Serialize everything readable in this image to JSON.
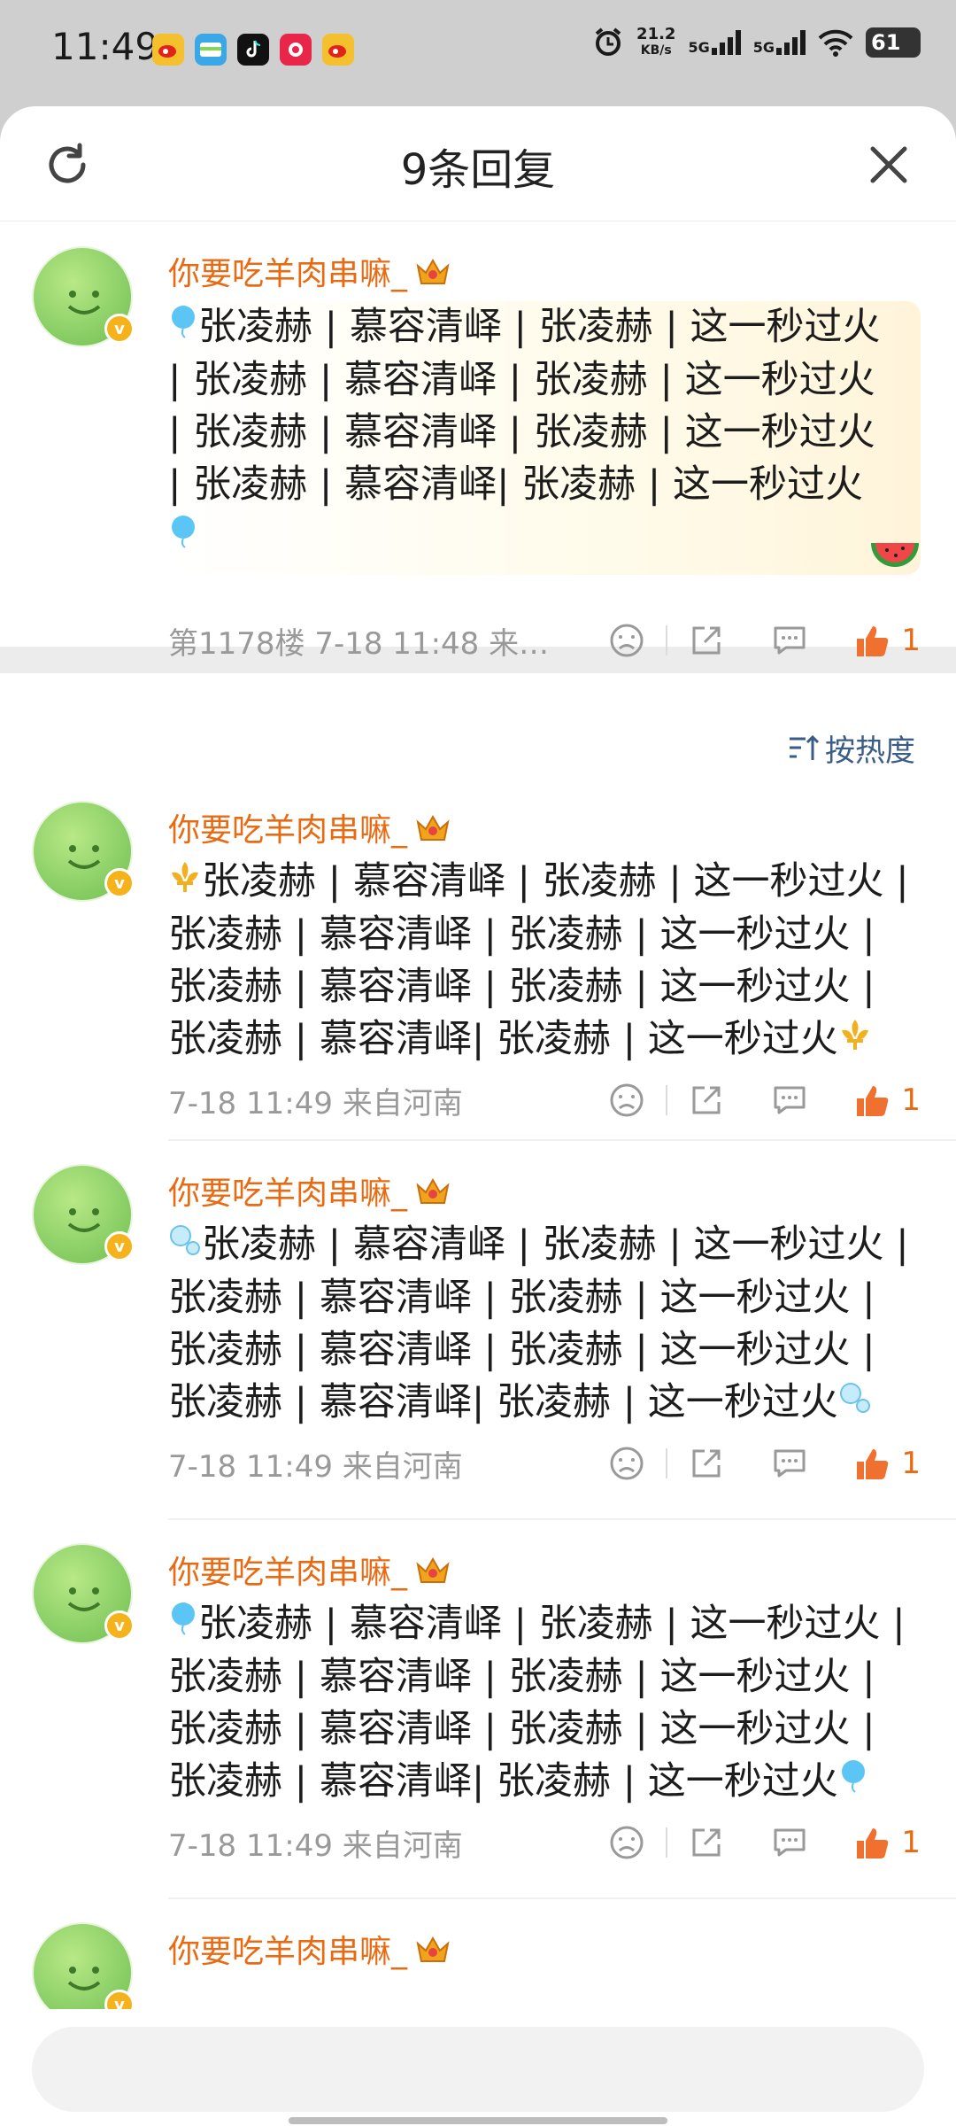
{
  "status_bar": {
    "time": "11:49",
    "speed_value": "21.2",
    "speed_unit": "KB/s",
    "signal1": "5G",
    "signal2": "5G",
    "battery": "61"
  },
  "sheet": {
    "title": "9条回复"
  },
  "pinned": {
    "username": "你要吃羊肉串嘛_",
    "content": "张凌赫 | 慕容清峄 | 张凌赫 | 这一秒过火 | 张凌赫 | 慕容清峄 | 张凌赫 | 这一秒过火 | 张凌赫 | 慕容清峄 | 张凌赫 | 这一秒过火 | 张凌赫 | 慕容清峄| 张凌赫 | 这一秒过火",
    "meta": "第1178楼 7-18 11:48 来…",
    "likes": "1"
  },
  "sort": {
    "label": "按热度"
  },
  "replies": [
    {
      "username": "你要吃羊肉串嘛_",
      "content": "张凌赫 | 慕容清峄 | 张凌赫 | 这一秒过火 | 张凌赫 | 慕容清峄 | 张凌赫 | 这一秒过火 | 张凌赫 | 慕容清峄 | 张凌赫 | 这一秒过火 | 张凌赫 | 慕容清峄| 张凌赫 | 这一秒过火",
      "meta": "7-18 11:49 来自河南",
      "likes": "1"
    },
    {
      "username": "你要吃羊肉串嘛_",
      "content": "张凌赫 | 慕容清峄 | 张凌赫 | 这一秒过火 | 张凌赫 | 慕容清峄 | 张凌赫 | 这一秒过火 | 张凌赫 | 慕容清峄 | 张凌赫 | 这一秒过火 | 张凌赫 | 慕容清峄| 张凌赫 | 这一秒过火",
      "meta": "7-18 11:49 来自河南",
      "likes": "1"
    },
    {
      "username": "你要吃羊肉串嘛_",
      "content": "张凌赫 | 慕容清峄 | 张凌赫 | 这一秒过火 | 张凌赫 | 慕容清峄 | 张凌赫 | 这一秒过火 | 张凌赫 | 慕容清峄 | 张凌赫 | 这一秒过火 | 张凌赫 | 慕容清峄| 张凌赫 | 这一秒过火",
      "meta": "7-18 11:49 来自河南",
      "likes": "1"
    },
    {
      "username": "你要吃羊肉串嘛_"
    }
  ],
  "colors": {
    "accent": "#e86b14",
    "link": "#3b5c86",
    "badge": "#f6b21b"
  },
  "icons": [
    "refresh-icon",
    "close-icon",
    "crown-icon",
    "verified-icon",
    "dislike-icon",
    "share-icon",
    "comment-icon",
    "like-icon",
    "sort-icon"
  ]
}
